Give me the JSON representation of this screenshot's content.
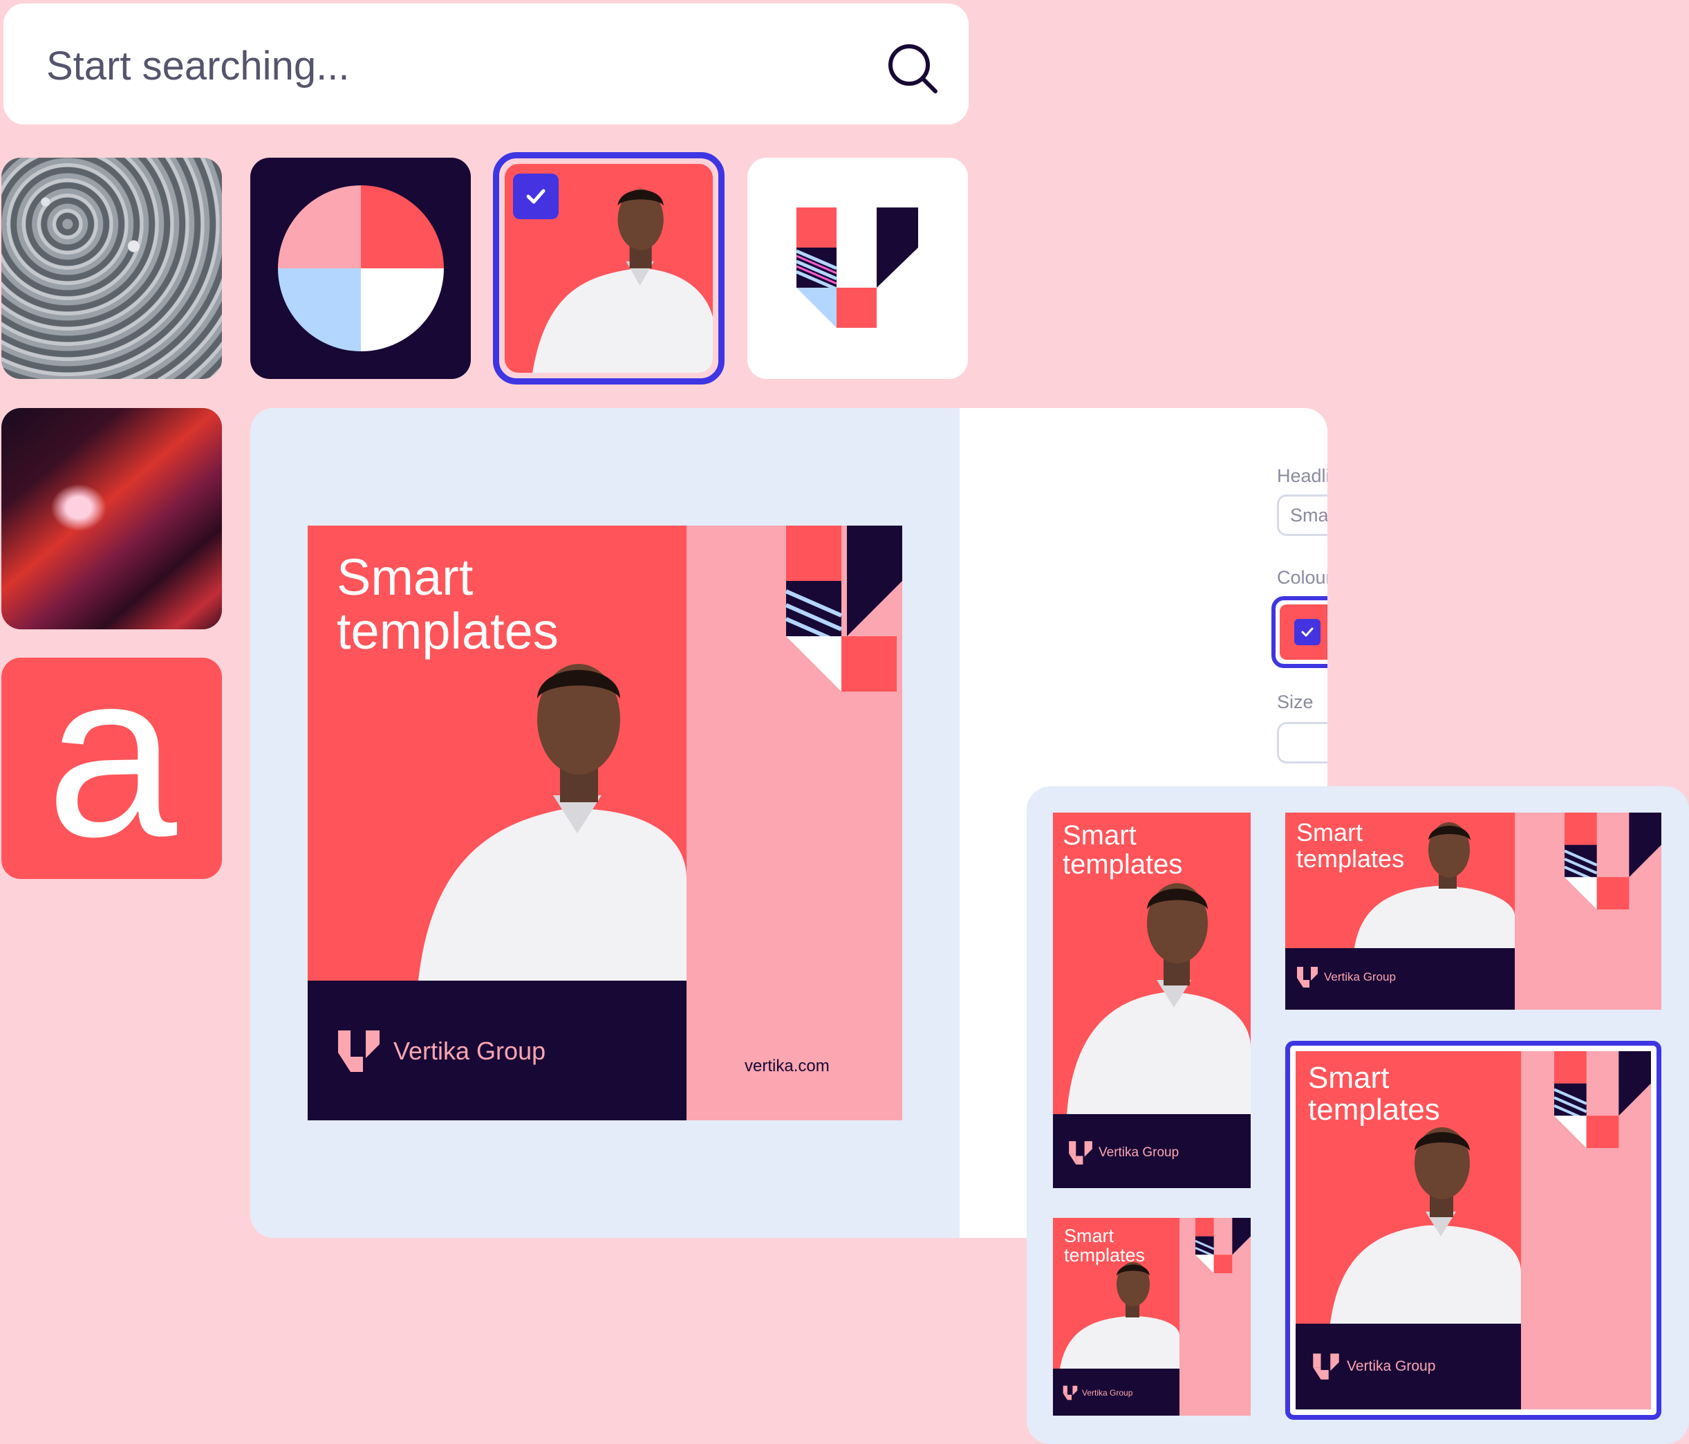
{
  "search": {
    "placeholder": "Start searching..."
  },
  "assets": [
    {
      "name": "forest-photo"
    },
    {
      "name": "pie-graphic"
    },
    {
      "name": "portrait-photo",
      "selected": true
    },
    {
      "name": "vertika-logo-mark"
    },
    {
      "name": "canyon-photo"
    },
    {
      "name": "letter-a",
      "letter": "a"
    }
  ],
  "template": {
    "headline": "Smart templates",
    "brand": "Vertika Group",
    "url": "vertika.com"
  },
  "properties": {
    "headline_label": "Headline",
    "headline_value": "Smart templates",
    "colour_label": "Colour",
    "colours": [
      "#ff5459",
      "#fba6b0",
      "#b3d6ff"
    ],
    "selected_colour": 0,
    "size_label": "Size",
    "size_value": ""
  },
  "colors": {
    "background": "#fdd3d9",
    "accent": "#3e36e2",
    "red": "#ff5459",
    "pink": "#fba6b0",
    "navy": "#180836",
    "blue": "#b3d6ff",
    "panel": "#e4ecf9"
  }
}
